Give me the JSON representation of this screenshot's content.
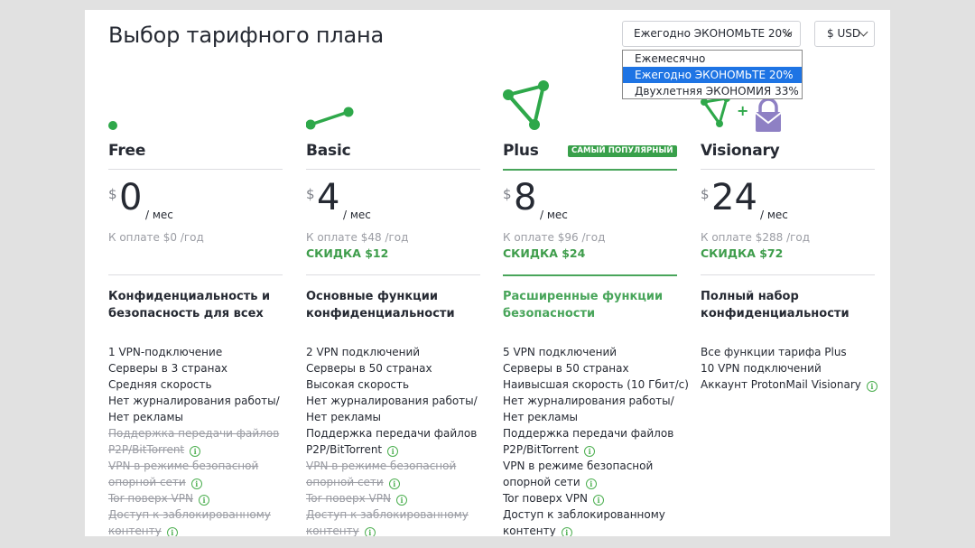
{
  "title": "Выбор тарифного плана",
  "billing": {
    "selected": "Ежегодно ЭКОНОМЬТЕ 20%",
    "options": [
      "Ежемесячно",
      "Ежегодно ЭКОНОМЬТЕ 20%",
      "Двухлетняя ЭКОНОМИЯ 33%"
    ]
  },
  "currency": {
    "selected": "$ USD"
  },
  "colors": {
    "accent_green": "#2ea84a",
    "badge_green": "#38a04a",
    "selected_option": "#1e74e4",
    "proton_purple": "#8e80c4"
  },
  "plans": [
    {
      "name": "Free",
      "currency_symbol": "$",
      "price": "0",
      "per": "/ мес",
      "billed": "К оплате $0 /год",
      "discount": "",
      "summary": "Конфиденциальность и безопасность для всех",
      "features": [
        {
          "text": "1 VPN-подключение"
        },
        {
          "text": "Серверы в 3 странах"
        },
        {
          "text": "Средняя скорость"
        },
        {
          "text": "Нет журналирования работы/"
        },
        {
          "text": "Нет рекламы"
        },
        {
          "text": "Поддержка передачи файлов"
        },
        {
          "text": "P2P/BitTorrent"
        },
        {
          "text": "VPN в режиме безопасной"
        },
        {
          "text": "опорной сети"
        },
        {
          "text": "Tor поверх VPN"
        },
        {
          "text": "Доступ к заблокированному"
        },
        {
          "text": "контенту"
        }
      ]
    },
    {
      "name": "Basic",
      "currency_symbol": "$",
      "price": "4",
      "per": "/ мес",
      "billed": "К оплате $48 /год",
      "discount": "СКИДКА $12",
      "summary": "Основные функции конфиденциальности",
      "features": [
        {
          "text": "2 VPN подключений"
        },
        {
          "text": "Серверы в 50 странах"
        },
        {
          "text": "Высокая скорость"
        },
        {
          "text": "Нет журналирования работы/"
        },
        {
          "text": "Нет рекламы"
        },
        {
          "text": "Поддержка передачи файлов"
        },
        {
          "text": "P2P/BitTorrent"
        },
        {
          "text": "VPN в режиме безопасной"
        },
        {
          "text": "опорной сети"
        },
        {
          "text": "Tor поверх VPN"
        },
        {
          "text": "Доступ к заблокированному"
        },
        {
          "text": "контенту"
        }
      ]
    },
    {
      "name": "Plus",
      "badge": "САМЫЙ ПОПУЛЯРНЫЙ",
      "currency_symbol": "$",
      "price": "8",
      "per": "/ мес",
      "billed": "К оплате $96 /год",
      "discount": "СКИДКА $24",
      "summary": "Расширенные функции безопасности",
      "features": [
        {
          "text": "5 VPN подключений"
        },
        {
          "text": "Серверы в 50 странах"
        },
        {
          "text": "Наивысшая скорость (10 Гбит/с)"
        },
        {
          "text": "Нет журналирования работы/"
        },
        {
          "text": "Нет рекламы"
        },
        {
          "text": "Поддержка передачи файлов"
        },
        {
          "text": "P2P/BitTorrent"
        },
        {
          "text": "VPN в режиме безопасной"
        },
        {
          "text": "опорной сети"
        },
        {
          "text": "Tor поверх VPN"
        },
        {
          "text": "Доступ к заблокированному"
        },
        {
          "text": "контенту"
        }
      ]
    },
    {
      "name": "Visionary",
      "plus_sign": "+",
      "currency_symbol": "$",
      "price": "24",
      "per": "/ мес",
      "billed": "К оплате $288 /год",
      "discount": "СКИДКА $72",
      "summary": "Полный набор конфиденциальности",
      "features": [
        {
          "text": "Все функции тарифа Plus"
        },
        {
          "text": "10 VPN подключений"
        },
        {
          "text": "Аккаунт ProtonMail Visionary"
        }
      ]
    }
  ],
  "info_icon_glyph": "i"
}
